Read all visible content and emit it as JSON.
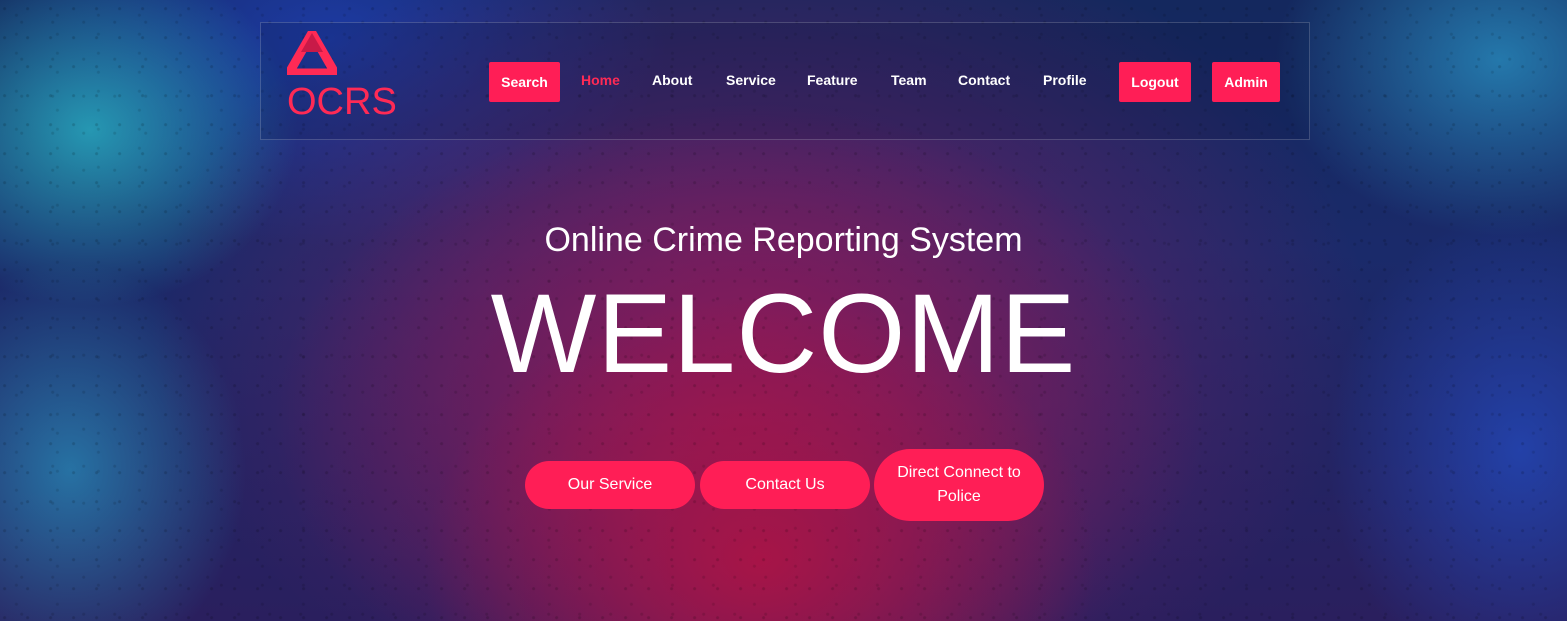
{
  "brand": {
    "name": "OCRS",
    "icon": "triangle-logo-icon",
    "color": "#ff2a55"
  },
  "nav": {
    "search_label": "Search",
    "links": [
      "Home",
      "About",
      "Service",
      "Feature",
      "Team",
      "Contact",
      "Profile"
    ],
    "active": "Home",
    "logout_label": "Logout",
    "admin_label": "Admin"
  },
  "hero": {
    "subtitle": "Online Crime Reporting System",
    "title": "WELCOME",
    "buttons": [
      "Our Service",
      "Contact Us",
      "Direct Connect to Police"
    ]
  },
  "colors": {
    "accent": "#ff1e56",
    "text": "#ffffff"
  }
}
